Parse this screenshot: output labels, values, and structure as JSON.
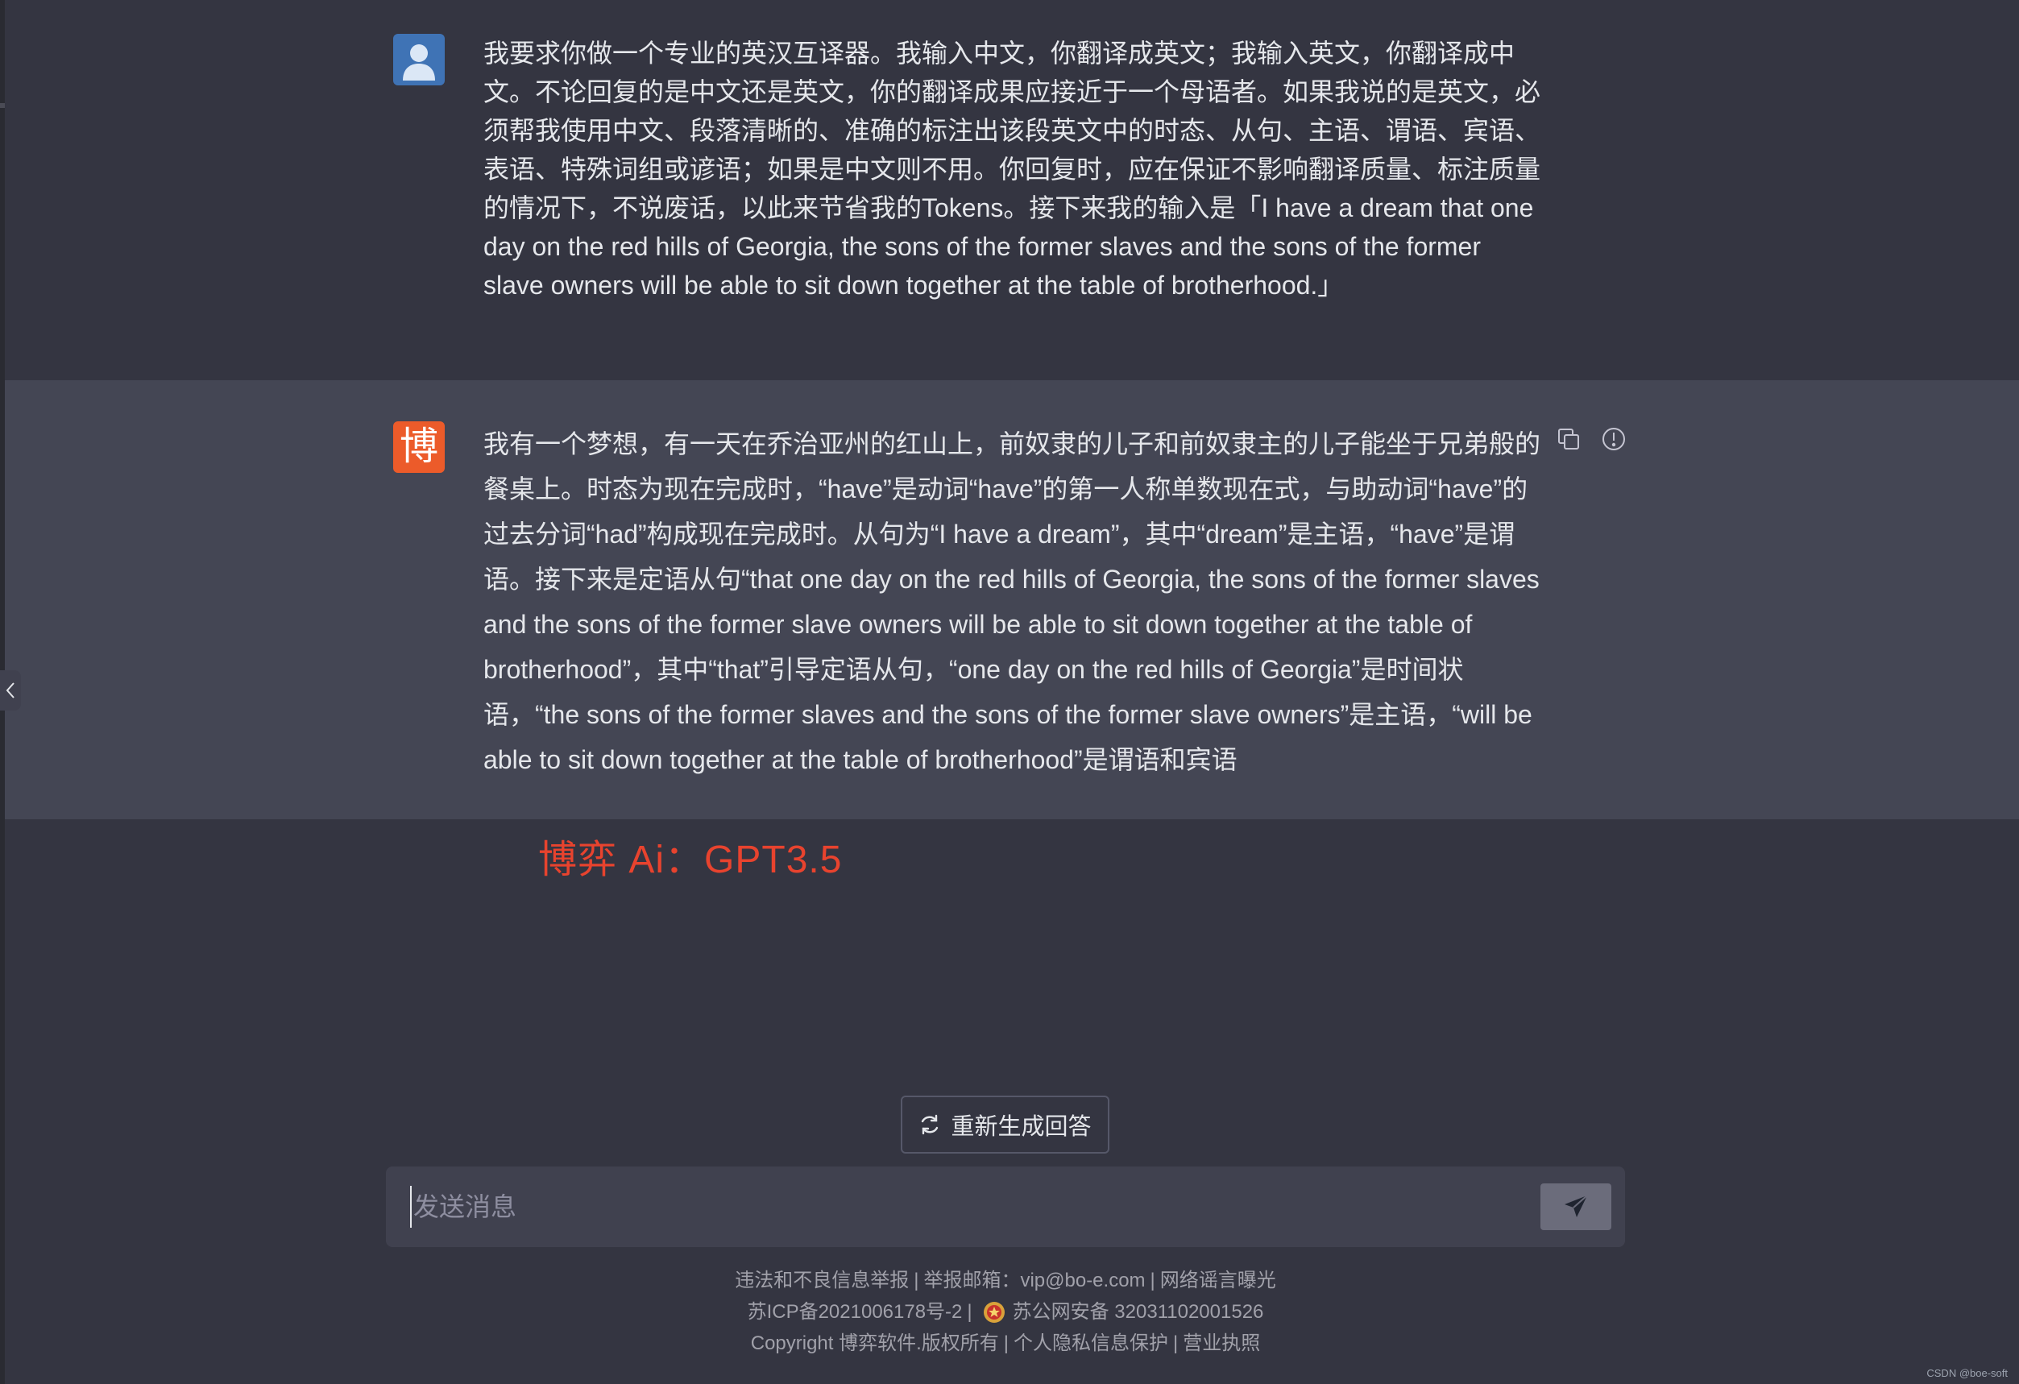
{
  "colors": {
    "background": "#343541",
    "bot_row_background": "#444654",
    "user_avatar": "#3f73b5",
    "bot_avatar": "#ec5b2a",
    "watermark": "#e8432e",
    "input_background": "#40414f",
    "send_button": "#6b6c7b"
  },
  "conversation": {
    "user_message": {
      "avatar_icon": "user-avatar-icon",
      "text": "我要求你做一个专业的英汉互译器。我输入中文，你翻译成英文；我输入英文，你翻译成中文。不论回复的是中文还是英文，你的翻译成果应接近于一个母语者。如果我说的是英文，必须帮我使用中文、段落清晰的、准确的标注出该段英文中的时态、从句、主语、谓语、宾语、表语、特殊词组或谚语；如果是中文则不用。你回复时，应在保证不影响翻译质量、标注质量的情况下，不说废话，以此来节省我的Tokens。接下来我的输入是「I have a dream that one day on the red hills of Georgia, the sons of the former slaves and the sons of the former slave owners will be able to sit down together at the table of brotherhood.」"
    },
    "bot_message": {
      "avatar_char": "博",
      "text": "我有一个梦想，有一天在乔治亚州的红山上，前奴隶的儿子和前奴隶主的儿子能坐于兄弟般的餐桌上。时态为现在完成时，“have”是动词“have”的第一人称单数现在式，与助动词“have”的过去分词“had”构成现在完成时。从句为“I have a dream”，其中“dream”是主语，“have”是谓语。接下来是定语从句“that one day on the red hills of Georgia, the sons of the former slaves and the sons of the former slave owners will be able to sit down together at the table of brotherhood”，其中“that”引导定语从句，“one day on the red hills of Georgia”是时间状语，“the sons of the former slaves and the sons of the former slave owners”是主语，“will be able to sit down together at the table of brotherhood”是谓语和宾语",
      "actions": [
        "copy-icon",
        "report-icon"
      ]
    }
  },
  "watermark": "博弈 Ai：GPT3.5",
  "regenerate": {
    "label": "重新生成回答",
    "icon": "refresh-icon"
  },
  "composer": {
    "placeholder": "发送消息",
    "value": "",
    "send_icon": "send-icon"
  },
  "footer": {
    "line1": {
      "report": "违法和不良信息举报",
      "email": "举报邮箱：vip@bo-e.com",
      "rumor": "网络谣言曝光"
    },
    "line2": {
      "icp": "苏ICP备2021006178号-2",
      "police": "苏公网安备 32031102001526",
      "police_icon": "police-badge-icon"
    },
    "line3": {
      "copyright": "Copyright 博弈软件.版权所有",
      "privacy": "个人隐私信息保护",
      "license": "营业执照"
    },
    "separator": "|"
  },
  "credit": "CSDN @boe-soft"
}
